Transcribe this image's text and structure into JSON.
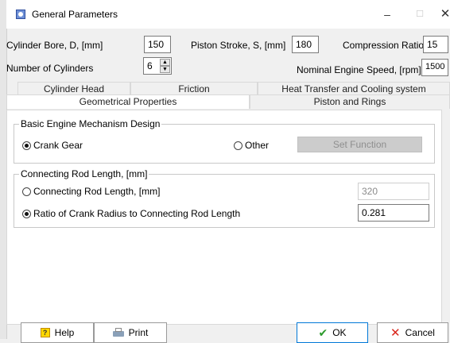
{
  "window": {
    "title": "General Parameters",
    "min_glyph": "–",
    "max_glyph": "☐",
    "close_glyph": "✕"
  },
  "header_fields": {
    "bore_label": "Cylinder Bore, D, [mm]",
    "bore_value": "150",
    "stroke_label": "Piston Stroke, S, [mm]",
    "stroke_value": "180",
    "compression_label": "Compression Ratio",
    "compression_value": "15",
    "cylinders_label": "Number of Cylinders",
    "cylinders_value": "6",
    "speed_label": "Nominal Engine Speed, [rpm]",
    "speed_value": "1500"
  },
  "tabs": {
    "row1": [
      "Cylinder Head",
      "Friction",
      "Heat Transfer and Cooling system"
    ],
    "row2": [
      "Geometrical Properties",
      "Piston and Rings"
    ],
    "active": "Geometrical Properties"
  },
  "mechanism_group": {
    "title": "Basic Engine Mechanism Design",
    "crank_gear_label": "Crank Gear",
    "crank_gear_selected": true,
    "other_label": "Other",
    "other_selected": false,
    "set_function_label": "Set Function"
  },
  "rod_group": {
    "title": "Connecting Rod Length, [mm]",
    "length_option_label": "Connecting Rod Length, [mm]",
    "length_value": "320",
    "length_selected": false,
    "ratio_option_label": "Ratio of Crank Radius to Connecting Rod Length",
    "ratio_value": "0.281",
    "ratio_selected": true
  },
  "buttons": {
    "help": "Help",
    "print": "Print",
    "ok": "OK",
    "cancel": "Cancel"
  },
  "colors": {
    "ok_check": "#2c9a2c",
    "cancel_x": "#d9261c",
    "help_icon": "#ffd800"
  }
}
